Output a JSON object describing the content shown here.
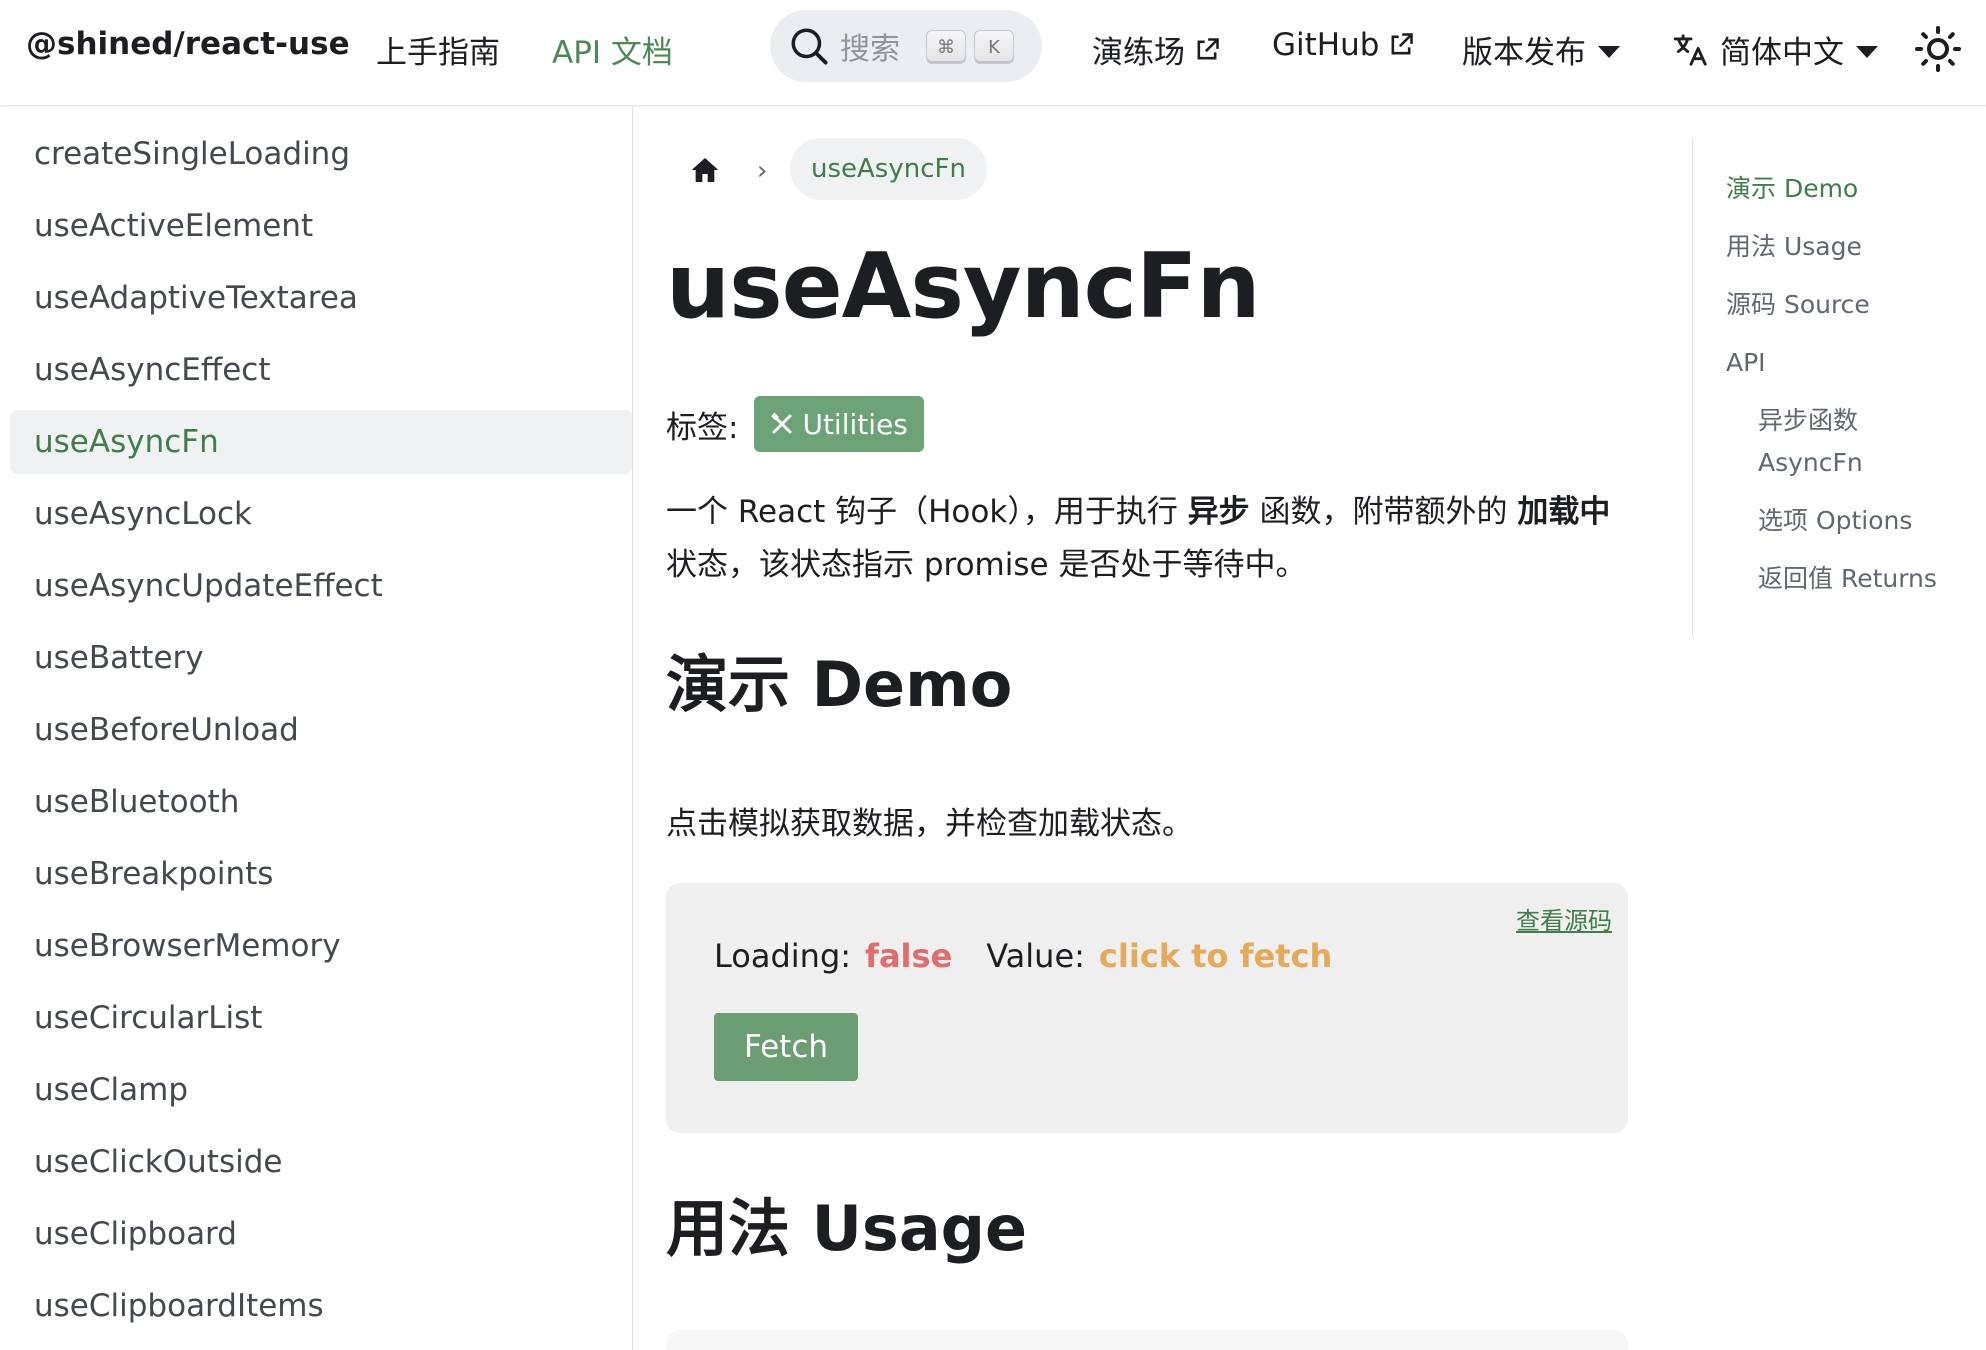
{
  "header": {
    "brand": "@shined/react-use",
    "nav": {
      "guide": "上手指南",
      "api": "API 文档",
      "playground": "演练场",
      "github": "GitHub",
      "releases": "版本发布",
      "language": "简体中文"
    },
    "search": {
      "placeholder": "搜索",
      "key_modifier": "⌘",
      "key_letter": "K"
    }
  },
  "sidebar": {
    "items": [
      "createSingleLoading",
      "useActiveElement",
      "useAdaptiveTextarea",
      "useAsyncEffect",
      "useAsyncFn",
      "useAsyncLock",
      "useAsyncUpdateEffect",
      "useBattery",
      "useBeforeUnload",
      "useBluetooth",
      "useBreakpoints",
      "useBrowserMemory",
      "useCircularList",
      "useClamp",
      "useClickOutside",
      "useClipboard",
      "useClipboardItems"
    ],
    "active": "useAsyncFn"
  },
  "main": {
    "breadcrumb": "useAsyncFn",
    "title": "useAsyncFn",
    "tags_label": "标签:",
    "tag": "Utilities",
    "desc": {
      "p1": "一个 React 钩子（Hook），用于执行 ",
      "b1": "异步",
      "p2": " 函数，附带额外的 ",
      "b2": "加载中",
      "p3": " 状态，该状态指示 promise 是否处于等待中。"
    },
    "demo_heading": "演示 Demo",
    "demo_text": "点击模拟获取数据，并检查加载状态。",
    "demo": {
      "view_source": "查看源码",
      "loading_label": "Loading:",
      "loading_value": "false",
      "value_label": "Value:",
      "value_value": "click to fetch",
      "fetch_button": "Fetch"
    },
    "usage_heading": "用法 Usage"
  },
  "toc": {
    "items": [
      {
        "label": "演示 Demo",
        "level": 1,
        "active": true
      },
      {
        "label": "用法 Usage",
        "level": 1,
        "active": false
      },
      {
        "label": "源码 Source",
        "level": 1,
        "active": false
      },
      {
        "label": "API",
        "level": 1,
        "active": false
      },
      {
        "label": "异步函数",
        "level": 2,
        "active": false
      },
      {
        "label": "AsyncFn",
        "level": 2,
        "active": false
      },
      {
        "label": "选项 Options",
        "level": 2,
        "active": false
      },
      {
        "label": "返回值 Returns",
        "level": 2,
        "active": false
      }
    ]
  },
  "colors": {
    "accent": "#4a8a56",
    "badge": "#6ba377",
    "false_value": "#e06c6c",
    "fetch_value": "#e6a958"
  }
}
